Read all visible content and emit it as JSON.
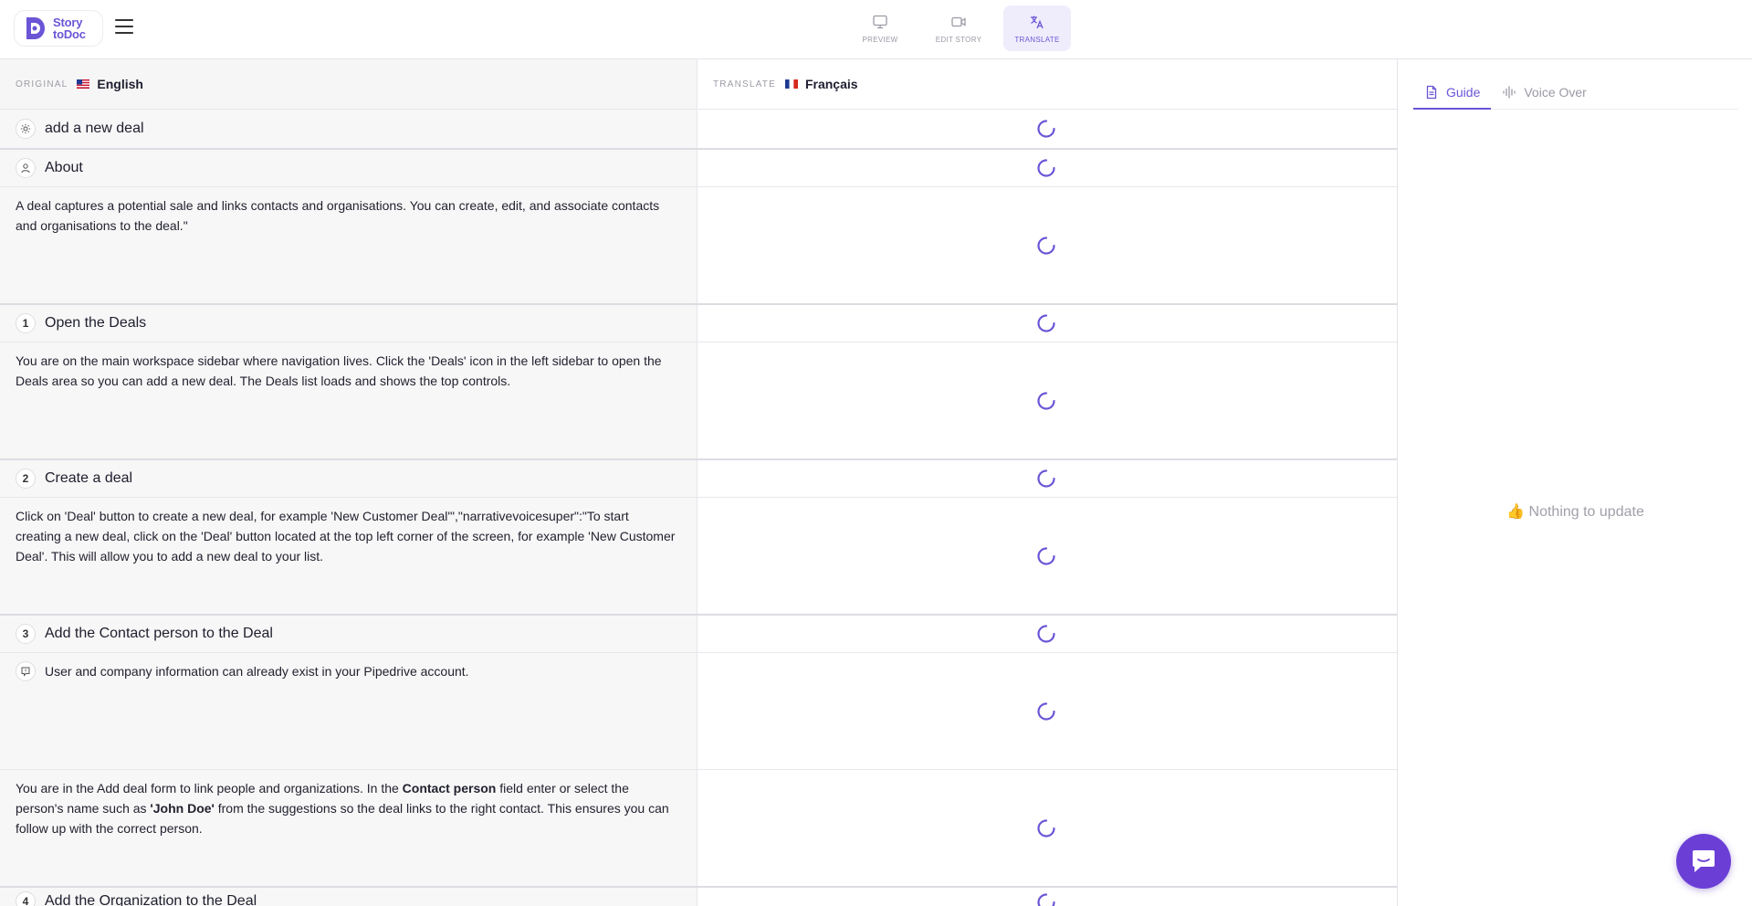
{
  "app": {
    "logo_line1": "Story",
    "logo_line2": "toDoc",
    "accent_color": "#6b55d6"
  },
  "modes": [
    {
      "label": "PREVIEW",
      "icon": "monitor-icon",
      "active": false
    },
    {
      "label": "EDIT STORY",
      "icon": "video-icon",
      "active": false
    },
    {
      "label": "TRANSLATE",
      "icon": "translate-icon",
      "active": true
    }
  ],
  "columns": {
    "original": {
      "kicker": "ORIGINAL",
      "language": "English",
      "flag": "us-flag-icon"
    },
    "translate": {
      "kicker": "TRANSLATE",
      "language": "Français",
      "flag": "fr-flag-icon"
    }
  },
  "rows": {
    "story_title": {
      "icon": "gear-icon",
      "text": "add a new deal"
    },
    "about_title": {
      "icon": "user-icon",
      "text": "About"
    },
    "about_text": "A deal captures a potential sale and links contacts and organisations. You can create, edit, and associate contacts and organisations to the deal.\"",
    "step1_num": "1",
    "step1_title": "Open the Deals",
    "step1_text": "You are on the main workspace sidebar where navigation lives. Click the 'Deals' icon in the left sidebar to open the Deals area so you can add a new deal. The Deals list loads and shows the top controls.",
    "step2_num": "2",
    "step2_title": "Create a deal",
    "step2_text": "Click on 'Deal' button to create a new deal, for example 'New Customer Deal'\",\"narrativevoicesuper\":\"To start creating a new deal, click on the 'Deal' button located at the top left corner of the screen, for example 'New Customer Deal'. This will allow you to add a new deal to your list.",
    "step3_num": "3",
    "step3_title": "Add the Contact person to the Deal",
    "step3_tip": "User and company information can already exist in your Pipedrive account.",
    "step3_text_a": "You are in the Add deal form to link people and organizations. In the ",
    "step3_text_b": "Contact person",
    "step3_text_c": " field enter or select the person's name such as ",
    "step3_text_d": "'John Doe'",
    "step3_text_e": " from the suggestions so the deal links to the right contact. This ensures you can follow up with the correct person.",
    "step4_num": "4",
    "step4_title": "Add the Organization to the Deal"
  },
  "side": {
    "tabs": [
      {
        "label": "Guide",
        "icon": "document-icon",
        "active": true
      },
      {
        "label": "Voice Over",
        "icon": "waveform-icon",
        "active": false
      }
    ],
    "empty_emoji": "👍",
    "empty_text": "Nothing to update"
  }
}
